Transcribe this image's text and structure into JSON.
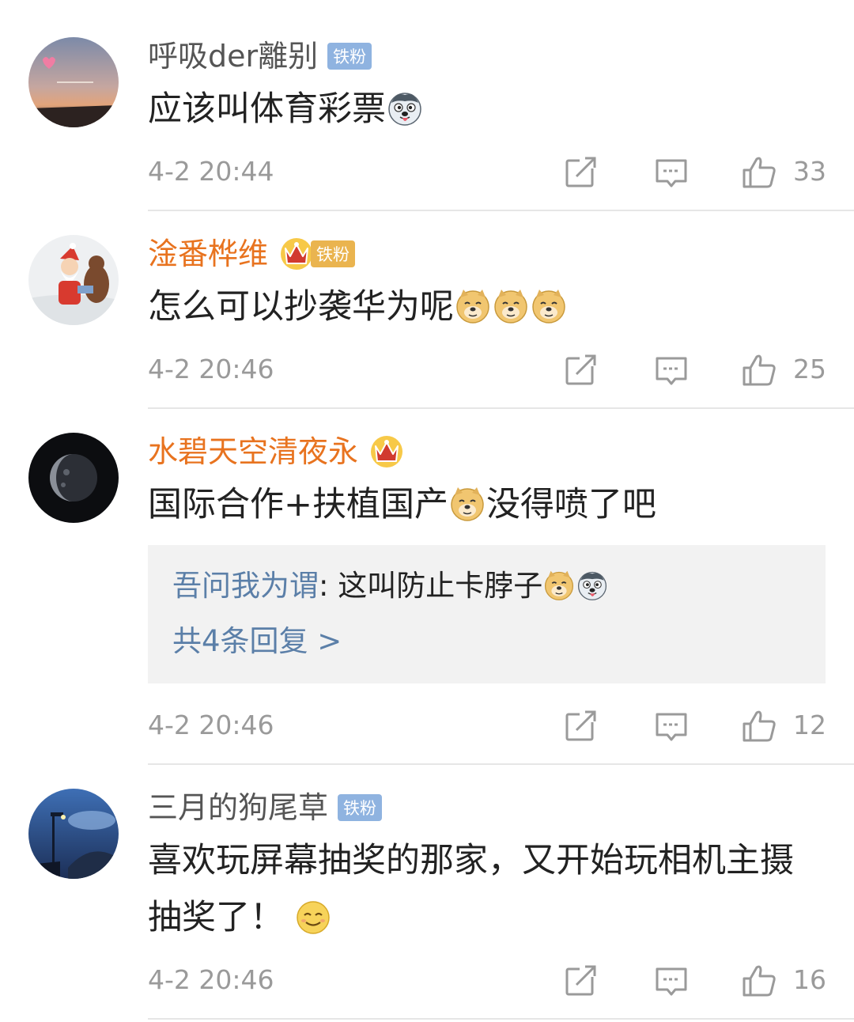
{
  "comments": [
    {
      "username": "呼吸der離别",
      "badge": "铁粉",
      "text": "应该叫体育彩票",
      "time": "4-2 20:44",
      "likes": "33"
    },
    {
      "username": "淦番桦维",
      "badge": "铁粉",
      "crown_level": "1",
      "text": "怎么可以抄袭华为呢",
      "time": "4-2 20:46",
      "likes": "25"
    },
    {
      "username": "水碧天空清夜永",
      "crown_level": "4",
      "text_a": "国际合作+扶植国产",
      "text_b": "没得喷了吧",
      "reply": {
        "user": "吾问我为谓",
        "separator": ": ",
        "text": "这叫防止卡脖子",
        "more": "共4条回复 >"
      },
      "time": "4-2 20:46",
      "likes": "12"
    },
    {
      "username": "三月的狗尾草",
      "badge": "铁粉",
      "text": "喜欢玩屏幕抽奖的那家，又开始玩相机主摄抽奖了！",
      "time": "4-2 20:46",
      "likes": "16"
    }
  ],
  "colors": {
    "username_normal": "#555555",
    "username_vip": "#e8731f",
    "badge_blue": "#8fb3e0",
    "link_blue": "#5b7fa8",
    "meta_gray": "#9a9a9a"
  },
  "icons": [
    "share-icon",
    "reply-icon",
    "like-icon",
    "crown-icon",
    "husky-emoji",
    "doge-emoji",
    "smile-emoji"
  ]
}
